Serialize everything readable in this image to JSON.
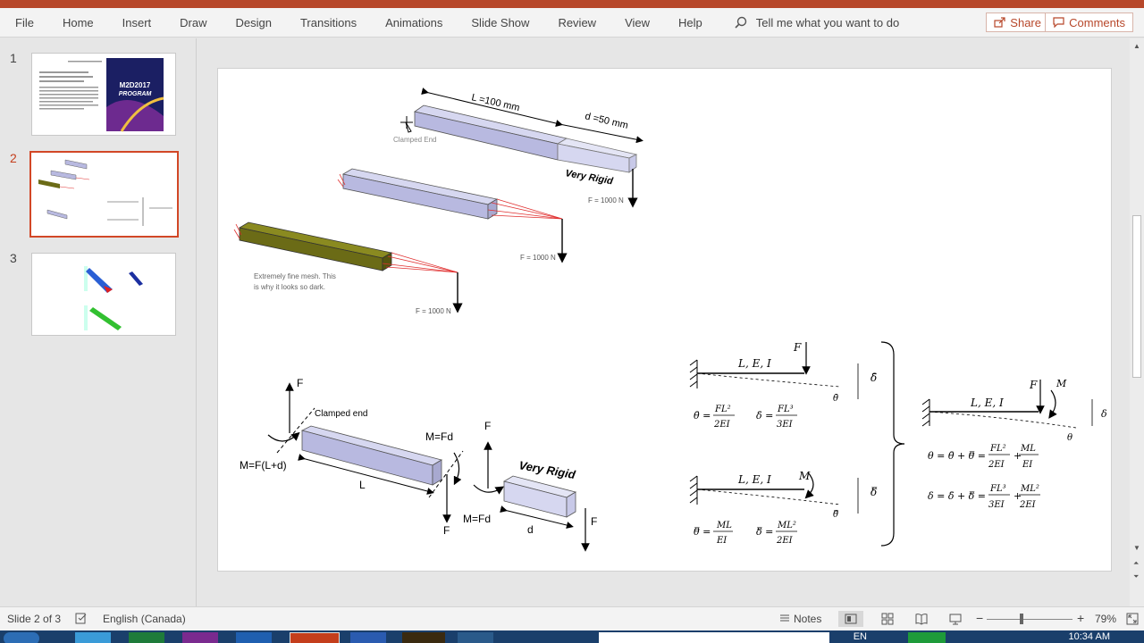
{
  "ribbon": {
    "tabs": [
      "File",
      "Home",
      "Insert",
      "Draw",
      "Design",
      "Transitions",
      "Animations",
      "Slide Show",
      "Review",
      "View",
      "Help"
    ],
    "tell_me": "Tell me what you want to do",
    "share_label": "Share",
    "comments_label": "Comments"
  },
  "thumbnails": {
    "numbers": [
      "1",
      "2",
      "3"
    ],
    "slide1": {
      "program_line1": "M2D2017",
      "program_line2": "PROGRAM"
    }
  },
  "slide": {
    "top": {
      "length_label": "L =100 mm",
      "depth_label": "d =50 mm",
      "clamped_label": "Clamped End",
      "very_rigid": "Very Rigid",
      "force1": "F = 1000 N",
      "force2": "F = 1000 N",
      "force3": "F = 1000 N",
      "mesh_note_line1": "Extremely fine mesh. This",
      "mesh_note_line2": "is why it looks so dark."
    },
    "bottom": {
      "f_top": "F",
      "clamped_end": "Clamped end",
      "moment_left": "M=F(L+d)",
      "l_label": "L",
      "m_fd_top": "M=Fd",
      "f_bottom": "F",
      "f_rigid_top": "F",
      "very_rigid": "Very Rigid",
      "m_fd_bottom": "M=Fd",
      "d_label": "d",
      "f_right": "F"
    },
    "equations": {
      "lei_1": "L, E, I",
      "f_1": "F",
      "delta_bar": "δ̄",
      "theta_bar": "θ̄",
      "eq_theta_bar": "θ̄ =",
      "eq_theta_bar_num": "FL²",
      "eq_theta_bar_den": "2EI",
      "eq_delta_bar": "δ̄ =",
      "eq_delta_bar_num": "FL³",
      "eq_delta_bar_den": "3EI",
      "lei_2": "L, E, I",
      "m_2": "M",
      "delta_dbar": "δ̿",
      "theta_dbar": "θ̿",
      "eq_theta_dbar": "θ̿ =",
      "eq_theta_dbar_num": "ML",
      "eq_theta_dbar_den": "EI",
      "eq_delta_dbar": "δ̿ =",
      "eq_delta_dbar_num": "ML²",
      "eq_delta_dbar_den": "2EI",
      "lei_3": "L, E, I",
      "f_3": "F",
      "m_3": "M",
      "delta_3": "δ",
      "theta_3": "θ",
      "eq_theta": "θ = θ̄ + θ̿ =",
      "eq_theta_t1_num": "FL²",
      "eq_theta_t1_den": "2EI",
      "eq_theta_t2_num": "ML",
      "eq_theta_t2_den": "EI",
      "eq_delta": "δ = δ̄ + δ̿ =",
      "eq_delta_t1_num": "FL³",
      "eq_delta_t1_den": "3EI",
      "eq_delta_t2_num": "ML²",
      "eq_delta_t2_den": "2EI",
      "plus": "+"
    }
  },
  "status": {
    "slide_of": "Slide 2 of 3",
    "language": "English (Canada)",
    "notes_label": "Notes",
    "zoom_minus": "−",
    "zoom_plus": "+",
    "zoom_percent": "79%"
  },
  "taskbar": {
    "lang": "EN",
    "time": "10:34 AM"
  },
  "colors": {
    "accent": "#b7472a",
    "active_thumb": "#d24726",
    "beam_fill": "#b8b9e0",
    "mesh_fill": "#6b6b16",
    "red_lines": "#e03030"
  }
}
